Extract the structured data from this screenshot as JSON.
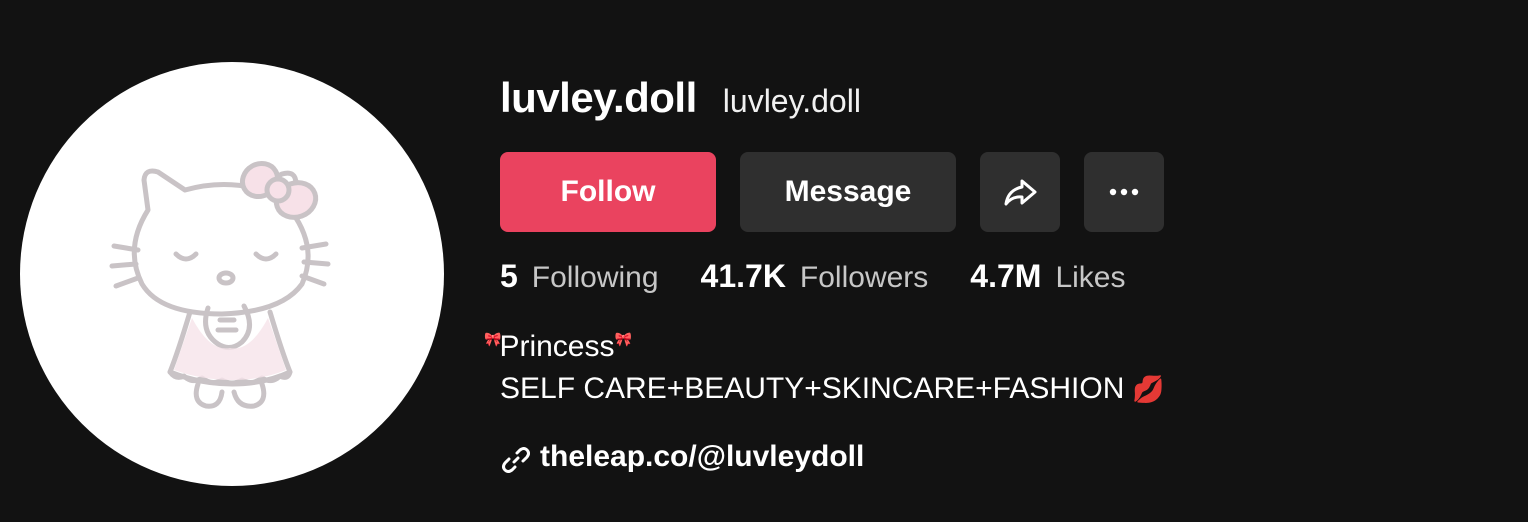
{
  "profile": {
    "unique_id": "luvley.doll",
    "nickname": "luvley.doll",
    "avatar_icon": "hello-kitty-avatar"
  },
  "actions": {
    "follow_label": "Follow",
    "message_label": "Message",
    "share_icon": "share-arrow-icon",
    "more_icon": "more-dots-icon"
  },
  "stats": [
    {
      "value": "5",
      "label": "Following"
    },
    {
      "value": "41.7K",
      "label": "Followers"
    },
    {
      "value": "4.7M",
      "label": "Likes"
    }
  ],
  "bio": {
    "bow_left": "🎀",
    "line1": "Princess",
    "bow_right": "🎀",
    "line2": "SELF CARE+BEAUTY+SKINCARE+FASHION",
    "emoji": "💋"
  },
  "link": {
    "text": "theleap.co/@luvleydoll",
    "icon": "link-icon"
  },
  "colors": {
    "background": "#121212",
    "follow": "#ea435f",
    "secondary_button": "#2f2f2f",
    "muted_text": "#c7c7c7"
  }
}
